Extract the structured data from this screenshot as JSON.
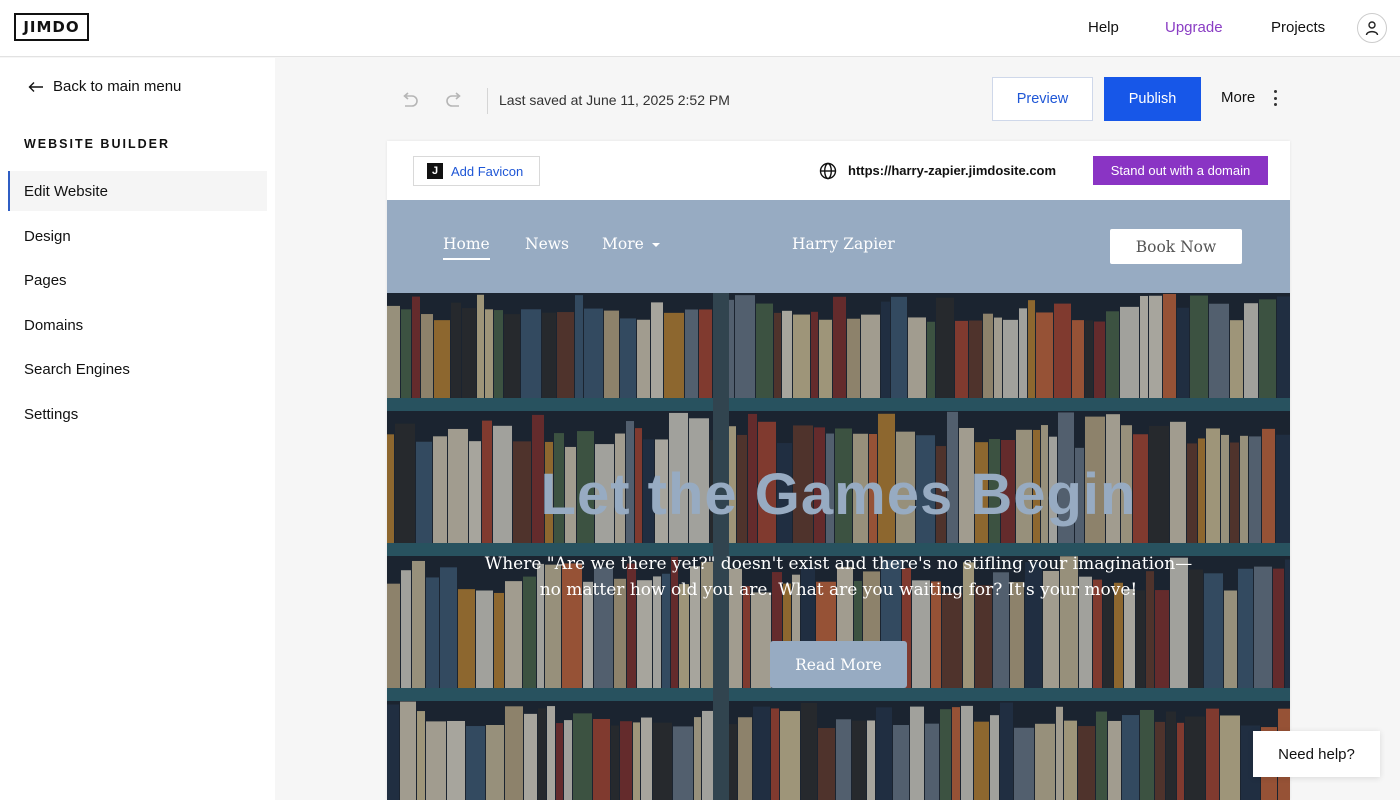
{
  "app": {
    "logo": "JIMDO"
  },
  "topbar": {
    "help": "Help",
    "upgrade": "Upgrade",
    "projects": "Projects"
  },
  "sidebar": {
    "back": "Back to main menu",
    "heading": "WEBSITE BUILDER",
    "items": [
      {
        "label": "Edit Website",
        "active": true
      },
      {
        "label": "Design",
        "active": false
      },
      {
        "label": "Pages",
        "active": false
      },
      {
        "label": "Domains",
        "active": false
      },
      {
        "label": "Search Engines",
        "active": false
      },
      {
        "label": "Settings",
        "active": false
      }
    ]
  },
  "toolbar": {
    "saved": "Last saved at June 11, 2025 2:52 PM",
    "preview": "Preview",
    "publish": "Publish",
    "more": "More"
  },
  "preview_bar": {
    "favicon_letter": "J",
    "add_favicon": "Add Favicon",
    "url": "https://harry-zapier.jimdosite.com",
    "domain_cta": "Stand out with a domain"
  },
  "site": {
    "nav": {
      "home": "Home",
      "news": "News",
      "more": "More"
    },
    "name": "Harry Zapier",
    "book": "Book Now",
    "hero": {
      "title": "Let the Games Begin",
      "subtitle": "Where \"Are we there yet?\" doesn't exist and there's no stifling your imagination—no matter how old you are. What are you waiting for? It's your move!",
      "cta": "Read More"
    }
  },
  "help": {
    "label": "Need help?"
  },
  "colors": {
    "accent_blue": "#1757e8",
    "upgrade_purple": "#8a3dc4",
    "domain_purple": "#8a34c4",
    "site_header": "#97abc2"
  }
}
